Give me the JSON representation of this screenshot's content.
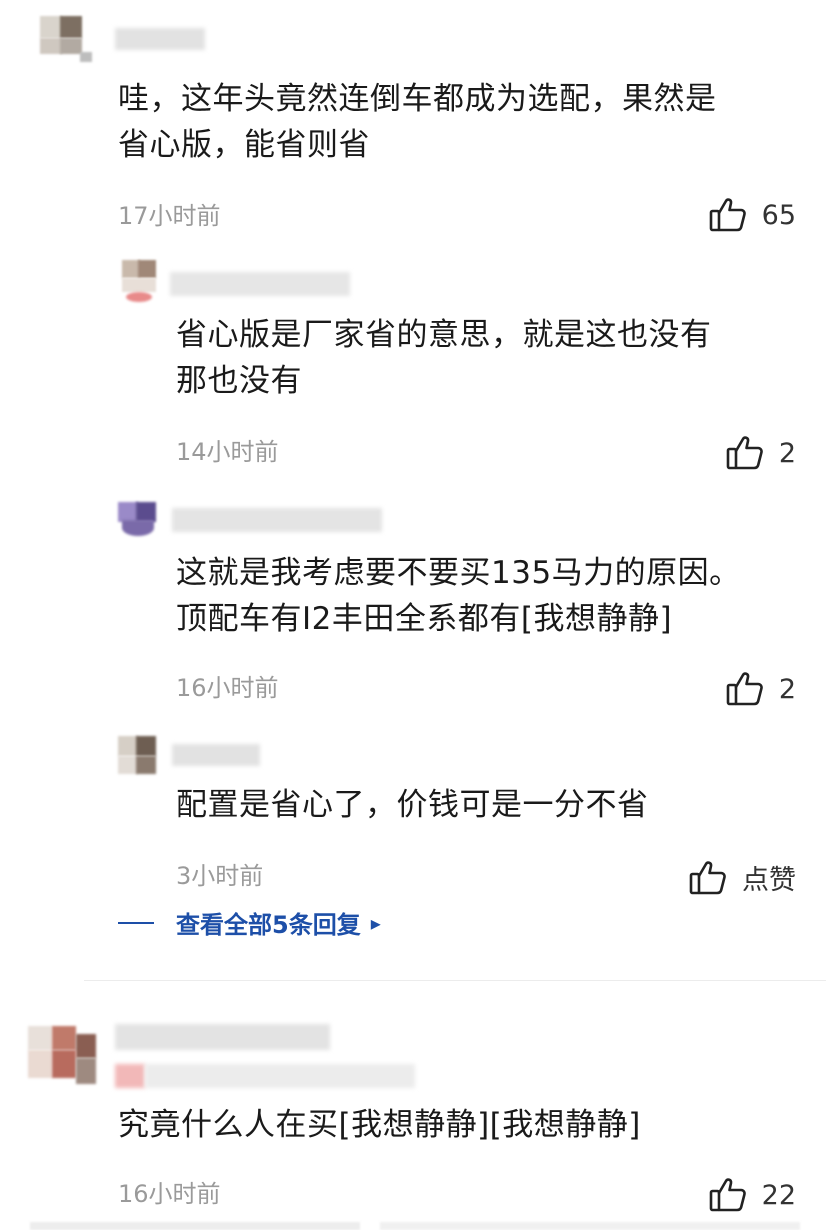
{
  "comments": [
    {
      "text": "哇，这年头竟然连倒车都成为选配，果然是\n省心版，能省则省",
      "time": "17小时前",
      "likes": "65"
    },
    {
      "text": "省心版是厂家省的意思，就是这也没有\n那也没有",
      "time": "14小时前",
      "likes": "2"
    },
    {
      "text": "这就是我考虑要不要买135马力的原因。\n顶配车有I2丰田全系都有[我想静静]",
      "time": "16小时前",
      "likes": "2"
    },
    {
      "text": "配置是省心了，价钱可是一分不省",
      "time": "3小时前",
      "likes": "点赞"
    },
    {
      "text": "究竟什么人在买[我想静静][我想静静]",
      "time": "16小时前",
      "likes": "22"
    }
  ],
  "view_more": {
    "label": "查看全部5条回复",
    "arrow": "▸"
  },
  "icons": {
    "like": "thumbs-up-icon"
  },
  "colors": {
    "link": "#1d4fa8",
    "time": "#9a9a9a",
    "text": "#1a1a1a"
  }
}
